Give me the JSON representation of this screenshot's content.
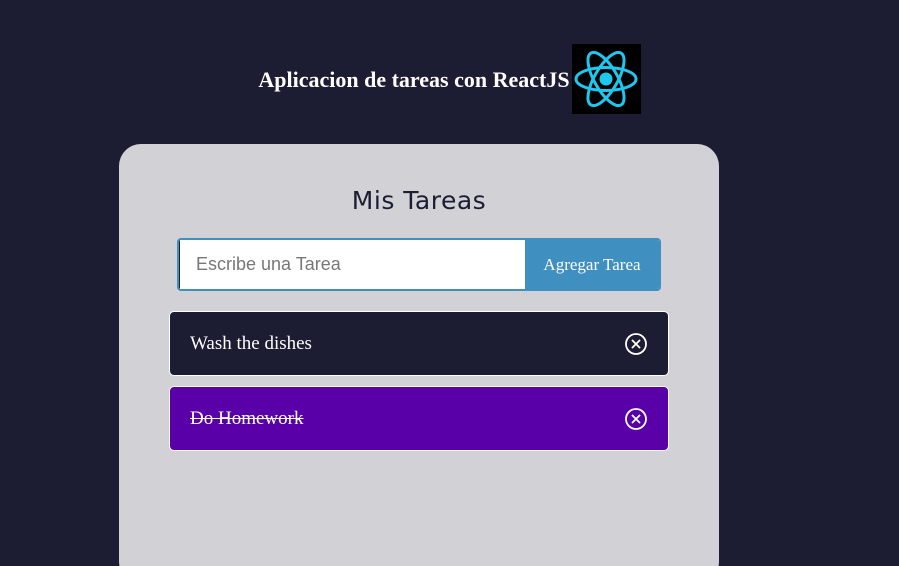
{
  "header": {
    "title": "Aplicacion de tareas con ReactJS",
    "logo_icon": "react-logo-icon",
    "logo_color": "#1fc7ee"
  },
  "card": {
    "title": "Mis Tareas"
  },
  "form": {
    "input_value": "",
    "input_placeholder": "Escribe una Tarea",
    "add_button_label": "Agregar Tarea"
  },
  "tasks": [
    {
      "text": "Wash the dishes",
      "completed": false,
      "delete_icon": "close-circle-icon"
    },
    {
      "text": "Do Homework",
      "completed": true,
      "delete_icon": "close-circle-icon"
    }
  ],
  "colors": {
    "background": "#1c1c32",
    "card": "#d2d1d6",
    "accent": "#3f8fc0",
    "pending_task": "#1c1c32",
    "completed_task": "#5a00a8"
  }
}
